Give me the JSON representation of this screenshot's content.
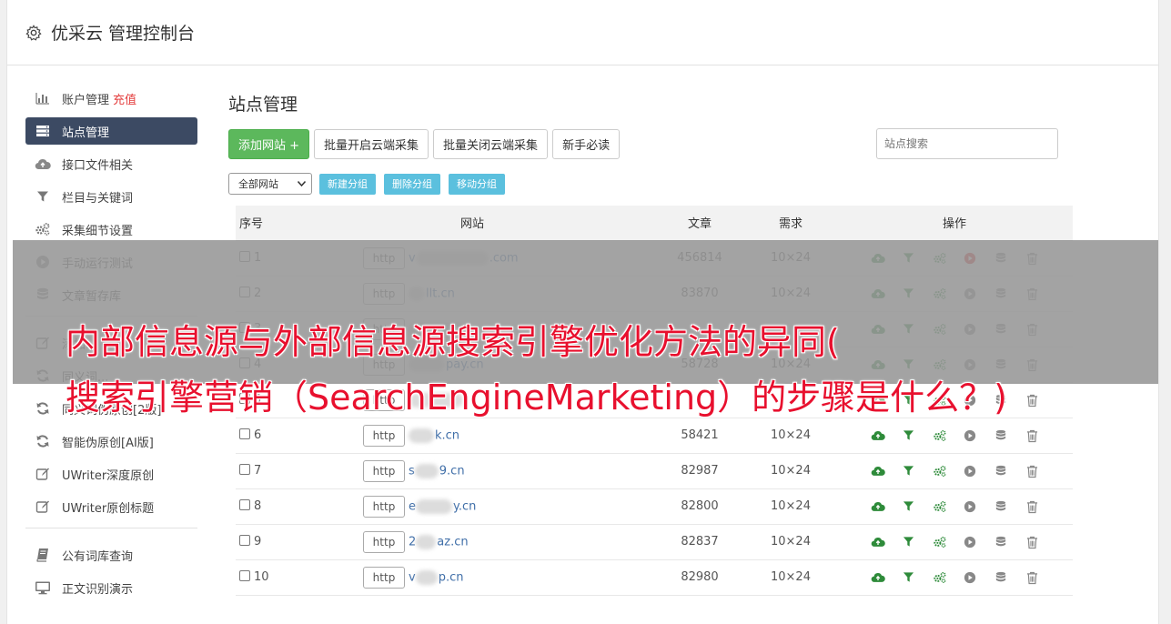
{
  "header": {
    "title": "优采云 管理控制台"
  },
  "sidebar": {
    "items": [
      {
        "label": "账户管理",
        "extra": "充值",
        "icon": "bar-chart-icon"
      },
      {
        "label": "站点管理",
        "icon": "server-icon",
        "active": true
      },
      {
        "label": "接口文件相关",
        "icon": "cloud-upload-icon"
      },
      {
        "label": "栏目与关键词",
        "icon": "filter-icon"
      },
      {
        "label": "采集细节设置",
        "icon": "gears-icon"
      },
      {
        "label": "手动运行测试",
        "icon": "play-circle-icon"
      },
      {
        "label": "文章暂存库",
        "icon": "database-icon"
      },
      {
        "label": "添加...",
        "icon": "edit-icon"
      },
      {
        "label": "同义词...",
        "icon": "refresh-icon"
      },
      {
        "label": "同义词伪原创[2版]",
        "icon": "refresh-icon"
      },
      {
        "label": "智能伪原创[AI版]",
        "icon": "refresh-icon"
      },
      {
        "label": "UWriter深度原创",
        "icon": "edit-icon"
      },
      {
        "label": "UWriter原创标题",
        "icon": "edit-icon"
      },
      {
        "label": "公有词库查询",
        "icon": "book-icon"
      },
      {
        "label": "正文识别演示",
        "icon": "monitor-icon"
      }
    ]
  },
  "main": {
    "title": "站点管理",
    "toolbar": {
      "add_site": "添加网站 +",
      "batch_open": "批量开启云端采集",
      "batch_close": "批量关闭云端采集",
      "newbie": "新手必读",
      "search_placeholder": "站点搜索"
    },
    "group_bar": {
      "select_value": "全部网站",
      "new_group": "新建分组",
      "delete_group": "删除分组",
      "move_group": "移动分组"
    },
    "table": {
      "headers": {
        "no": "序号",
        "site": "网站",
        "articles": "文章",
        "demand": "需求",
        "ops": "操作"
      },
      "http_label": "http",
      "rows": [
        {
          "no": "1",
          "prefix": "v",
          "suffix": ".com",
          "articles": "456814",
          "demand": "10×24",
          "active_play": true
        },
        {
          "no": "2",
          "prefix": "",
          "suffix": "llt.cn",
          "articles": "83870",
          "demand": "10×24",
          "active_play": false
        },
        {
          "no": "3",
          "prefix": "",
          "suffix": "",
          "articles": "",
          "demand": "",
          "active_play": false
        },
        {
          "no": "4",
          "prefix": "",
          "suffix": "pay.cn",
          "articles": "58728",
          "demand": "10×24",
          "active_play": false
        },
        {
          "no": "5",
          "prefix": "",
          "suffix": "",
          "articles": "",
          "demand": "",
          "active_play": false
        },
        {
          "no": "6",
          "prefix": "",
          "suffix": "k.cn",
          "articles": "58421",
          "demand": "10×24",
          "active_play": false
        },
        {
          "no": "7",
          "prefix": "s",
          "suffix": "9.cn",
          "articles": "82987",
          "demand": "10×24",
          "active_play": false
        },
        {
          "no": "8",
          "prefix": "e",
          "suffix": "y.cn",
          "articles": "82800",
          "demand": "10×24",
          "active_play": false
        },
        {
          "no": "9",
          "prefix": "2",
          "suffix": "az.cn",
          "articles": "82837",
          "demand": "10×24",
          "active_play": false
        },
        {
          "no": "10",
          "prefix": "v",
          "suffix": "p.cn",
          "articles": "82980",
          "demand": "10×24",
          "active_play": false
        }
      ]
    }
  },
  "overlay": {
    "line1": "内部信息源与外部信息源搜索引擎优化方法的异同(",
    "line2": "搜索引擎营销（SearchEngineMarketing）的步骤是什么？)"
  },
  "colors": {
    "sidebar_active": "#3c4a63",
    "green": "#5cb85c",
    "info": "#5bc0de",
    "link": "#3f6ea8",
    "headline": "#e8102e"
  }
}
